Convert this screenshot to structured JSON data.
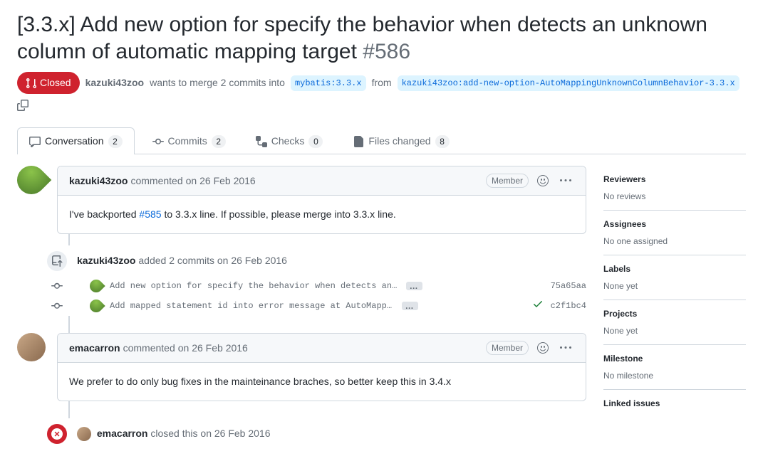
{
  "title": "[3.3.x] Add new option for specify the behavior when detects an unknown column of automatic mapping target",
  "issue_number": "#586",
  "state": {
    "label": "Closed"
  },
  "merge_line": {
    "author": "kazuki43zoo",
    "text1": "wants to merge 2 commits into",
    "base_branch": "mybatis:3.3.x",
    "text2": "from",
    "head_branch": "kazuki43zoo:add-new-option-AutoMappingUnknownColumnBehavior-3.3.x"
  },
  "tabs": {
    "conversation": {
      "label": "Conversation",
      "count": "2"
    },
    "commits": {
      "label": "Commits",
      "count": "2"
    },
    "checks": {
      "label": "Checks",
      "count": "0"
    },
    "files": {
      "label": "Files changed",
      "count": "8"
    }
  },
  "comments": [
    {
      "author": "kazuki43zoo",
      "verb": "commented",
      "date": "on 26 Feb 2016",
      "role": "Member",
      "body_pre": "I've backported ",
      "body_link": "#585",
      "body_post": " to 3.3.x line. If possible, please merge into 3.3.x line."
    },
    {
      "author": "emacarron",
      "verb": "commented",
      "date": "on 26 Feb 2016",
      "role": "Member",
      "body": "We prefer to do only bug fixes in the mainteinance braches, so better keep this in 3.4.x"
    }
  ],
  "push_event": {
    "author": "kazuki43zoo",
    "text": "added 2 commits",
    "date": "on 26 Feb 2016"
  },
  "commits": [
    {
      "msg": "Add new option for specify the behavior when detects an unknown colum…",
      "sha": "75a65aa",
      "status": "none"
    },
    {
      "msg": "Add mapped statement id into error message at AutoMappingUnknownColum…",
      "sha": "c2f1bc4",
      "status": "success"
    }
  ],
  "close_event": {
    "author": "emacarron",
    "text": "closed this",
    "date": "on 26 Feb 2016"
  },
  "sidebar": {
    "reviewers": {
      "title": "Reviewers",
      "value": "No reviews"
    },
    "assignees": {
      "title": "Assignees",
      "value": "No one assigned"
    },
    "labels": {
      "title": "Labels",
      "value": "None yet"
    },
    "projects": {
      "title": "Projects",
      "value": "None yet"
    },
    "milestone": {
      "title": "Milestone",
      "value": "No milestone"
    },
    "linked": {
      "title": "Linked issues"
    }
  }
}
